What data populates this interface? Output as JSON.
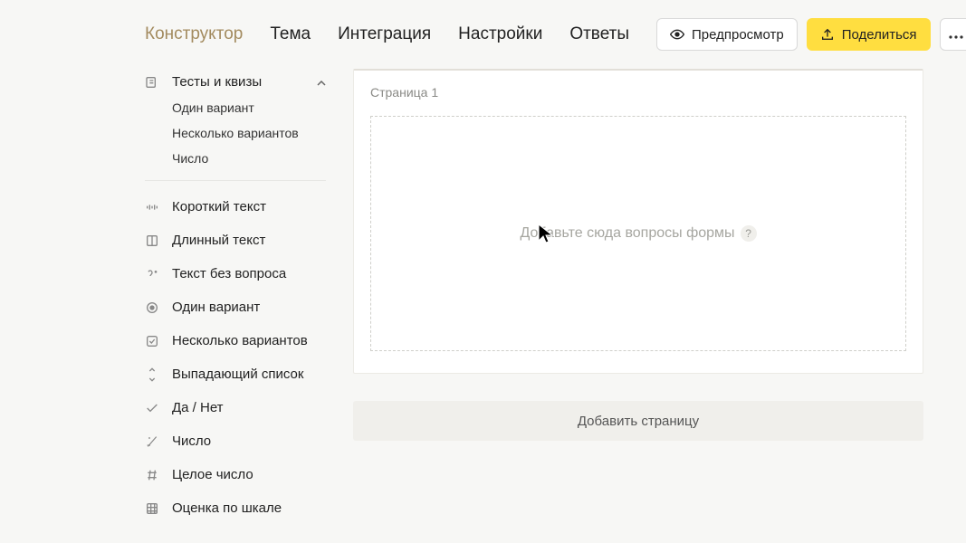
{
  "tabs": {
    "constructor": "Конструктор",
    "theme": "Тема",
    "integration": "Интеграция",
    "settings": "Настройки",
    "answers": "Ответы"
  },
  "actions": {
    "preview": "Предпросмотр",
    "share": "Поделиться"
  },
  "sidebar": {
    "tests_group": "Тесты и квизы",
    "subs": {
      "one_variant": "Один вариант",
      "several_variants": "Несколько вариантов",
      "number": "Число"
    },
    "items": {
      "short_text": "Короткий текст",
      "long_text": "Длинный текст",
      "no_question": "Текст без вопроса",
      "one_variant": "Один вариант",
      "several_variants": "Несколько вариантов",
      "dropdown": "Выпадающий список",
      "yes_no": "Да / Нет",
      "number": "Число",
      "integer": "Целое число",
      "scale": "Оценка по шкале"
    }
  },
  "main": {
    "page_label": "Страница 1",
    "drop_hint": "Добавьте сюда вопросы формы",
    "add_page": "Добавить страницу"
  }
}
